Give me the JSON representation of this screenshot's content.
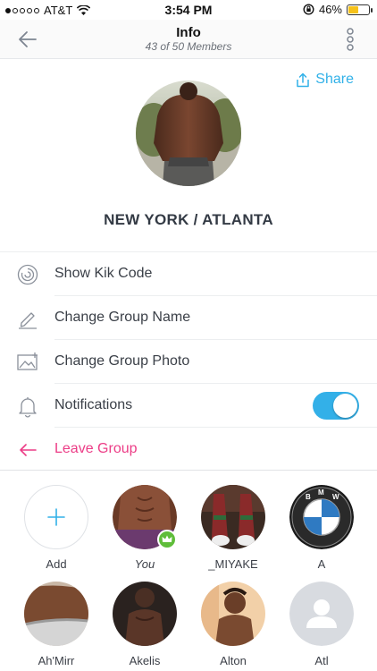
{
  "status_bar": {
    "carrier": "AT&T",
    "time": "3:54 PM",
    "battery": "46%",
    "battery_level": 0.46,
    "signal_dots_filled": 1,
    "icons": [
      "signal-dots-icon",
      "wifi-icon",
      "orientation-lock-icon",
      "battery-icon"
    ]
  },
  "navbar": {
    "title": "Info",
    "subtitle": "43 of 50 Members",
    "back_icon": "back-arrow-icon",
    "more_icon": "vertical-dots-icon"
  },
  "header": {
    "share_label": "Share",
    "share_icon": "share-icon",
    "group_name": "NEW YORK / ATLANTA"
  },
  "menu": {
    "items": [
      {
        "label": "Show Kik Code",
        "icon": "kik-code-icon"
      },
      {
        "label": "Change Group Name",
        "icon": "pencil-icon"
      },
      {
        "label": "Change Group Photo",
        "icon": "photo-icon"
      },
      {
        "label": "Notifications",
        "icon": "bell-icon",
        "toggle_on": true
      },
      {
        "label": "Leave Group",
        "icon": "leave-arrow-icon"
      }
    ]
  },
  "members": [
    {
      "name": "Add",
      "icon": "plus-icon"
    },
    {
      "name": "You",
      "badge": "crown-icon"
    },
    {
      "name": "_MIYAKE"
    },
    {
      "name": "A"
    },
    {
      "name": "Ah'Mirr"
    },
    {
      "name": "Akelis"
    },
    {
      "name": "Alton"
    },
    {
      "name": "Atl",
      "icon": "default-avatar-icon"
    }
  ],
  "colors": {
    "accent": "#31b1e8",
    "danger": "#ec3c86",
    "toggle_on": "#33b0e8",
    "admin_badge": "#5fbd3a"
  }
}
